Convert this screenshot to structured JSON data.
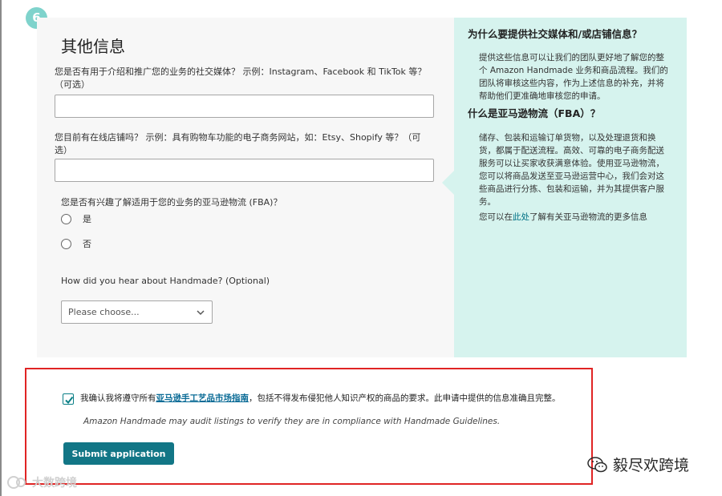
{
  "step": {
    "number": "6"
  },
  "form": {
    "title": "其他信息",
    "social_question": "您是否有用于介绍和推广您的业务的社交媒体？ 示例：Instagram、Facebook 和 TikTok 等？（可选）",
    "social_value": "",
    "store_question": "您目前有在线店铺吗？ 示例：具有购物车功能的电子商务网站，如：Etsy、Shopify 等？（可选）",
    "store_value": "",
    "fba_question": "您是否有兴趣了解适用于您的业务的亚马逊物流 (FBA)？",
    "fba_options": [
      "是",
      "否"
    ],
    "hear_question": "How did you hear about Handmade? (Optional)",
    "hear_select": "Please choose..."
  },
  "info": {
    "why_title": "为什么要提供社交媒体和/或店铺信息？",
    "why_body": "提供这些信息可以让我们的团队更好地了解您的整个 Amazon Handmade 业务和商品流程。我们的团队将审核这些内容，作为上述信息的补充，并将帮助他们更准确地审核您的申请。",
    "fba_title": "什么是亚马逊物流（FBA）？",
    "fba_body": "储存、包装和运输订单货物，以及处理退货和换货，都属于配送流程。高效、可靠的电子商务配送服务可以让买家收获满意体验。使用亚马逊物流，您可以将商品发送至亚马逊运营中心，我们会对这些商品进行分拣、包装和运输，并为其提供客户服务。",
    "more_prefix": "您可以在",
    "more_link": "此处",
    "more_suffix": "了解有关亚马逊物流的更多信息"
  },
  "confirm": {
    "checked": true,
    "prefix": "我确认我将遵守所有",
    "link": "亚马逊手工艺品市场指南",
    "suffix": "，包括不得发布侵犯他人知识产权的商品的要求。此申请中提供的信息准确且完整。",
    "audit_note": "Amazon Handmade may audit listings to verify they are in compliance with Handmade Guidelines.",
    "submit_label": "Submit application"
  },
  "watermarks": {
    "left": "大数跨境",
    "right": "毅尽欢跨境"
  },
  "colors": {
    "accent": "#127686",
    "info_bg": "#d6f3ee",
    "badge": "#7fd3cc",
    "frame": "#e02424"
  }
}
